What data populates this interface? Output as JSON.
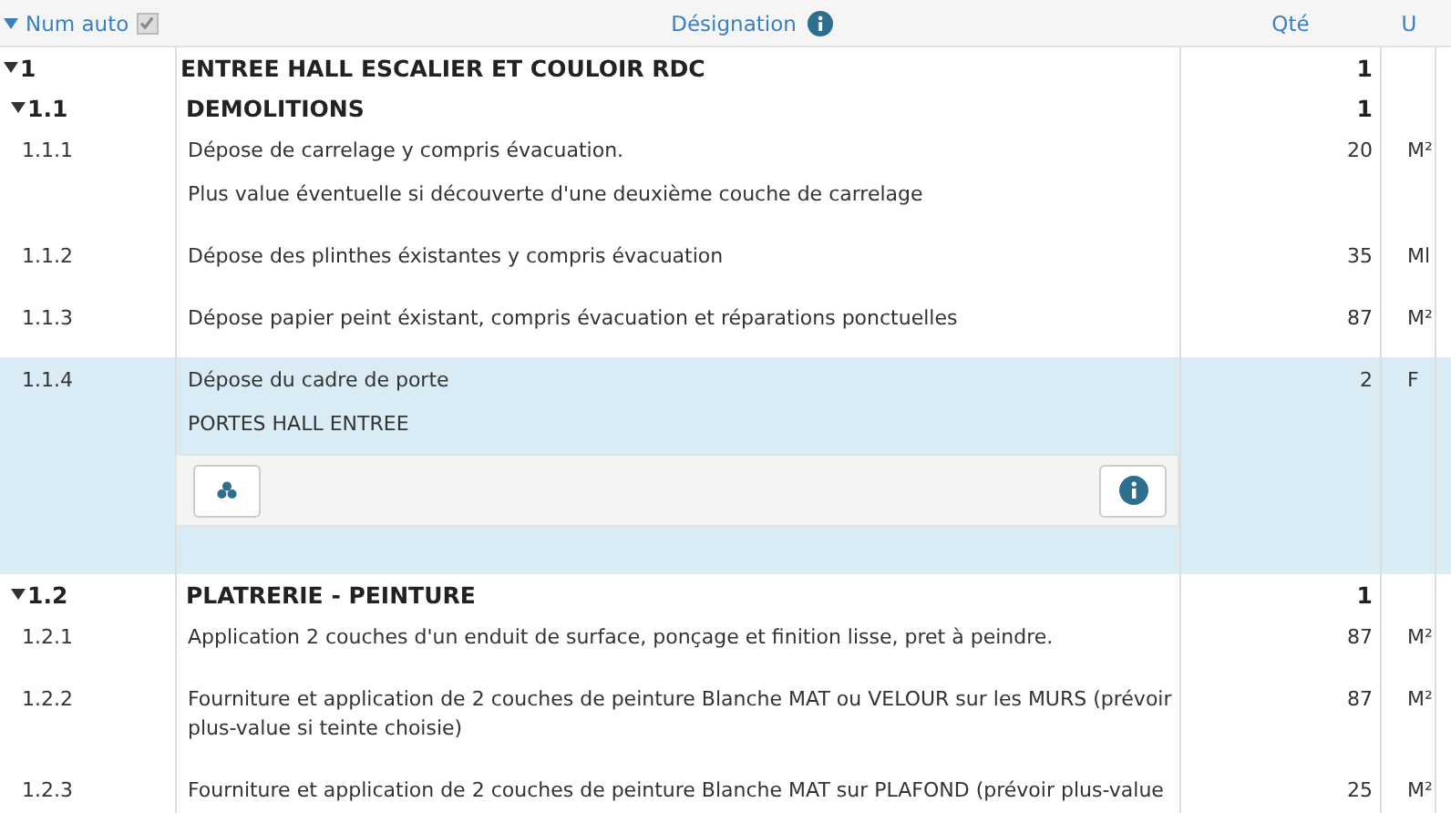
{
  "header": {
    "num_label": "Num auto",
    "num_auto_checked": true,
    "designation_label": "Désignation",
    "qty_label": "Qté",
    "unit_label": "U"
  },
  "rows": [
    {
      "kind": "chapter",
      "num": "1",
      "designation": "ENTREE HALL ESCALIER ET COULOIR RDC",
      "qty": "1",
      "expanded": true,
      "children": [
        {
          "kind": "chapter",
          "num": "1.1",
          "designation": "DEMOLITIONS",
          "qty": "1",
          "expanded": true,
          "children": [
            {
              "kind": "item",
              "num": "1.1.1",
              "designation": "Dépose de carrelage y compris évacuation.",
              "note": "Plus value éventuelle si découverte d'une deuxième couche de carrelage",
              "qty": "20",
              "unit": "M²",
              "selected": false
            },
            {
              "kind": "item",
              "num": "1.1.2",
              "designation": "Dépose des plinthes éxistantes y compris évacuation",
              "qty": "35",
              "unit": "Ml",
              "selected": false
            },
            {
              "kind": "item",
              "num": "1.1.3",
              "designation": "Dépose papier peint éxistant, compris évacuation et réparations ponctuelles",
              "qty": "87",
              "unit": "M²",
              "selected": false
            },
            {
              "kind": "item",
              "num": "1.1.4",
              "designation": "Dépose du cadre de porte",
              "note": "PORTES HALL ENTREE",
              "qty": "2",
              "unit": "F",
              "selected": true
            }
          ]
        },
        {
          "kind": "chapter",
          "num": "1.2",
          "designation": "PLATRERIE - PEINTURE",
          "qty": "1",
          "expanded": true,
          "children": [
            {
              "kind": "item",
              "num": "1.2.1",
              "designation": "Application 2 couches d'un enduit de surface, ponçage et finition lisse, pret à peindre.",
              "qty": "87",
              "unit": "M²",
              "selected": false
            },
            {
              "kind": "item",
              "num": "1.2.2",
              "designation": "Fourniture et application de 2 couches de peinture Blanche MAT ou VELOUR sur les MURS (prévoir plus-value si teinte choisie)",
              "qty": "87",
              "unit": "M²",
              "selected": false
            },
            {
              "kind": "item",
              "num": "1.2.3",
              "designation": "Fourniture et application de 2 couches de peinture Blanche MAT sur PLAFOND (prévoir plus-value",
              "qty": "25",
              "unit": "M²",
              "selected": false
            }
          ]
        }
      ]
    }
  ]
}
